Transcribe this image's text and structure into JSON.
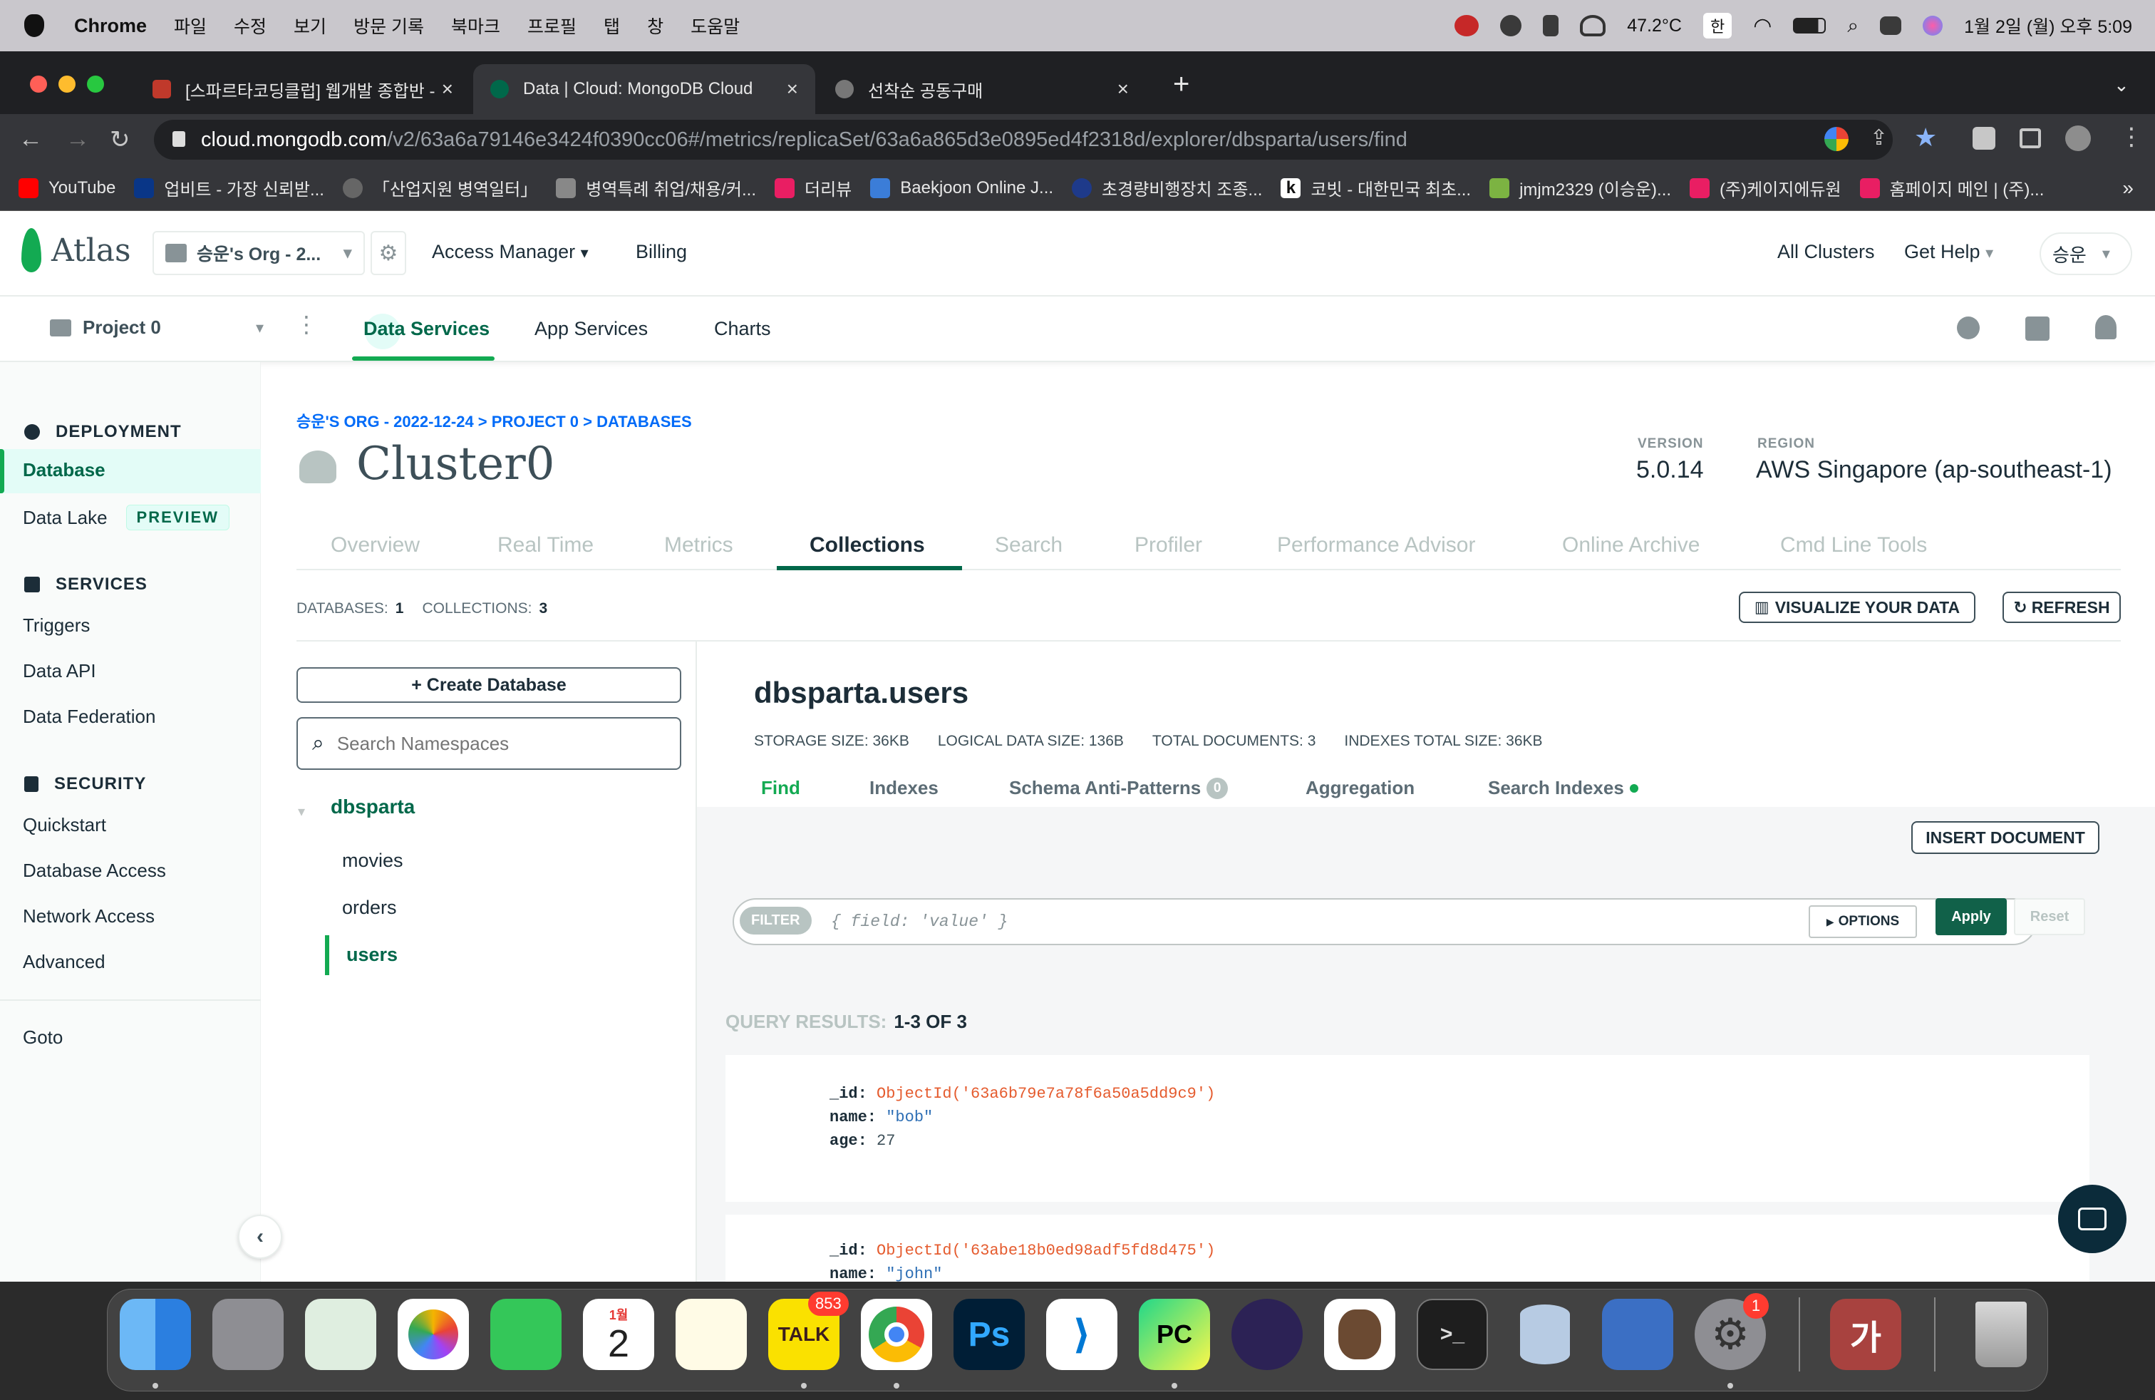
{
  "menubar": {
    "app": "Chrome",
    "items": [
      "파일",
      "수정",
      "보기",
      "방문 기록",
      "북마크",
      "프로필",
      "탭",
      "창",
      "도움말"
    ],
    "temperature": "47.2°C",
    "input_lang": "한",
    "datetime": "1월 2일 (월) 오후 5:09"
  },
  "chrome": {
    "tabs": [
      {
        "title": "[스파르타코딩클럽] 웹개발 종합반 -",
        "color": "#c0392b"
      },
      {
        "title": "Data | Cloud: MongoDB Cloud",
        "color": "#00684a"
      },
      {
        "title": "선착순 공동구매",
        "color": "#777777"
      }
    ],
    "url_host": "cloud.mongodb.com",
    "url_path": "/v2/63a6a79146e3424f0390cc06#/metrics/replicaSet/63a6a865d3e0895ed4f2318d/explorer/dbsparta/users/find",
    "bookmarks": [
      {
        "label": "YouTube",
        "color": "#ff0000"
      },
      {
        "label": "업비트 - 가장 신뢰받...",
        "color": "#093687"
      },
      {
        "label": "「산업지원 병역일터」",
        "color": "#666666"
      },
      {
        "label": "병역특례 취업/채용/커...",
        "color": "#888888"
      },
      {
        "label": "더리뷰",
        "color": "#e91e63"
      },
      {
        "label": "Baekjoon Online J...",
        "color": "#3b7dd8"
      },
      {
        "label": "초경량비행장치 조종...",
        "color": "#1e3a8a"
      },
      {
        "label": "코빗 - 대한민국 최초...",
        "color": "#111111"
      },
      {
        "label": "jmjm2329 (이승운)...",
        "color": "#7cb342"
      },
      {
        "label": "(주)케이지에듀원",
        "color": "#e91e63"
      },
      {
        "label": "홈페이지 메인 | (주)...",
        "color": "#e91e63"
      }
    ],
    "more": "»"
  },
  "atlas": {
    "logo": "Atlas",
    "org": "승운's Org - 2...",
    "access_manager": "Access Manager",
    "billing": "Billing",
    "all_clusters": "All Clusters",
    "get_help": "Get Help",
    "user": "승운",
    "project": "Project 0",
    "nav": [
      "Data Services",
      "App Services",
      "Charts"
    ]
  },
  "sidebar": {
    "deployment": "DEPLOYMENT",
    "database": "Database",
    "data_lake": "Data Lake",
    "preview": "PREVIEW",
    "services": "SERVICES",
    "service_items": [
      "Triggers",
      "Data API",
      "Data Federation"
    ],
    "security": "SECURITY",
    "security_items": [
      "Quickstart",
      "Database Access",
      "Network Access",
      "Advanced"
    ],
    "goto": "Goto"
  },
  "cluster": {
    "breadcrumb": "승운'S ORG - 2022-12-24 > PROJECT 0 > DATABASES",
    "name": "Cluster0",
    "version_label": "VERSION",
    "version": "5.0.14",
    "region_label": "REGION",
    "region": "AWS Singapore (ap-southeast-1)",
    "tabs": [
      "Overview",
      "Real Time",
      "Metrics",
      "Collections",
      "Search",
      "Profiler",
      "Performance Advisor",
      "Online Archive",
      "Cmd Line Tools"
    ]
  },
  "stats": {
    "databases_label": "DATABASES:",
    "databases": "1",
    "collections_label": "COLLECTIONS:",
    "collections": "3",
    "visualize": "VISUALIZE YOUR DATA",
    "refresh": "REFRESH"
  },
  "db_panel": {
    "create": "+ Create Database",
    "search_placeholder": "Search Namespaces",
    "db": "dbsparta",
    "collections": [
      "movies",
      "orders",
      "users"
    ]
  },
  "collection": {
    "title": "dbsparta.users",
    "storage": "STORAGE SIZE: 36KB",
    "logical": "LOGICAL DATA SIZE: 136B",
    "total_docs": "TOTAL DOCUMENTS: 3",
    "indexes_size": "INDEXES TOTAL SIZE: 36KB",
    "tabs": [
      "Find",
      "Indexes",
      "Schema Anti-Patterns",
      "Aggregation",
      "Search Indexes"
    ],
    "antipattern_count": "0",
    "insert": "INSERT DOCUMENT",
    "filter_label": "FILTER",
    "filter_placeholder": "{ field: 'value' }",
    "options": "OPTIONS",
    "apply": "Apply",
    "reset": "Reset",
    "results_label": "QUERY RESULTS:",
    "results_range": "1-3 OF 3",
    "docs": [
      {
        "id_key": "_id:",
        "id": "ObjectId('63a6b79e7a78f6a50a5dd9c9')",
        "name_key": "name:",
        "name": "\"bob\"",
        "age_key": "age:",
        "age": "27"
      },
      {
        "id_key": "_id:",
        "id": "ObjectId('63abe18b0ed98adf5fd8d475')",
        "name_key": "name:",
        "name": "\"john\""
      }
    ]
  },
  "dock": {
    "talk_badge": "853",
    "calendar_month": "1월",
    "calendar_day": "2",
    "settings_badge": "1"
  }
}
